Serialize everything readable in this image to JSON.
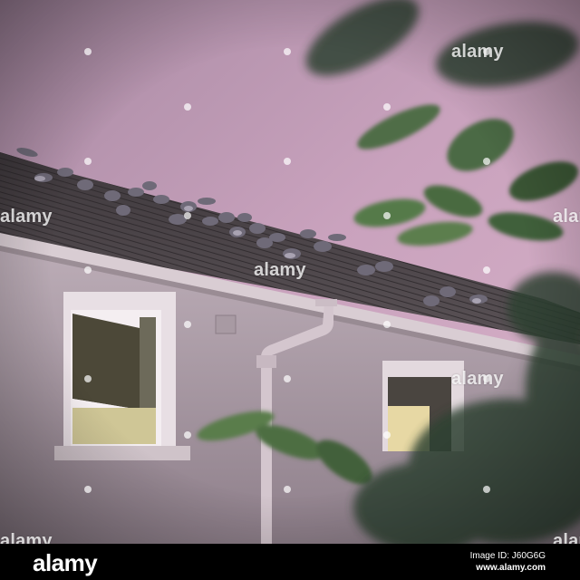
{
  "photo": {
    "watermark_text": "alamy",
    "colors": {
      "sky": "#c9a2bd",
      "roof": "#4d4648",
      "wall": "#b7a9b3",
      "gutter": "#d9cdd3",
      "window_frame": "#f1eaee",
      "leaves": "#3e5a3a",
      "pigeon": "#6f6a78"
    }
  },
  "footer": {
    "logo": "alamy",
    "image_id": "Image ID: J60G6G",
    "url": "www.alamy.com"
  }
}
